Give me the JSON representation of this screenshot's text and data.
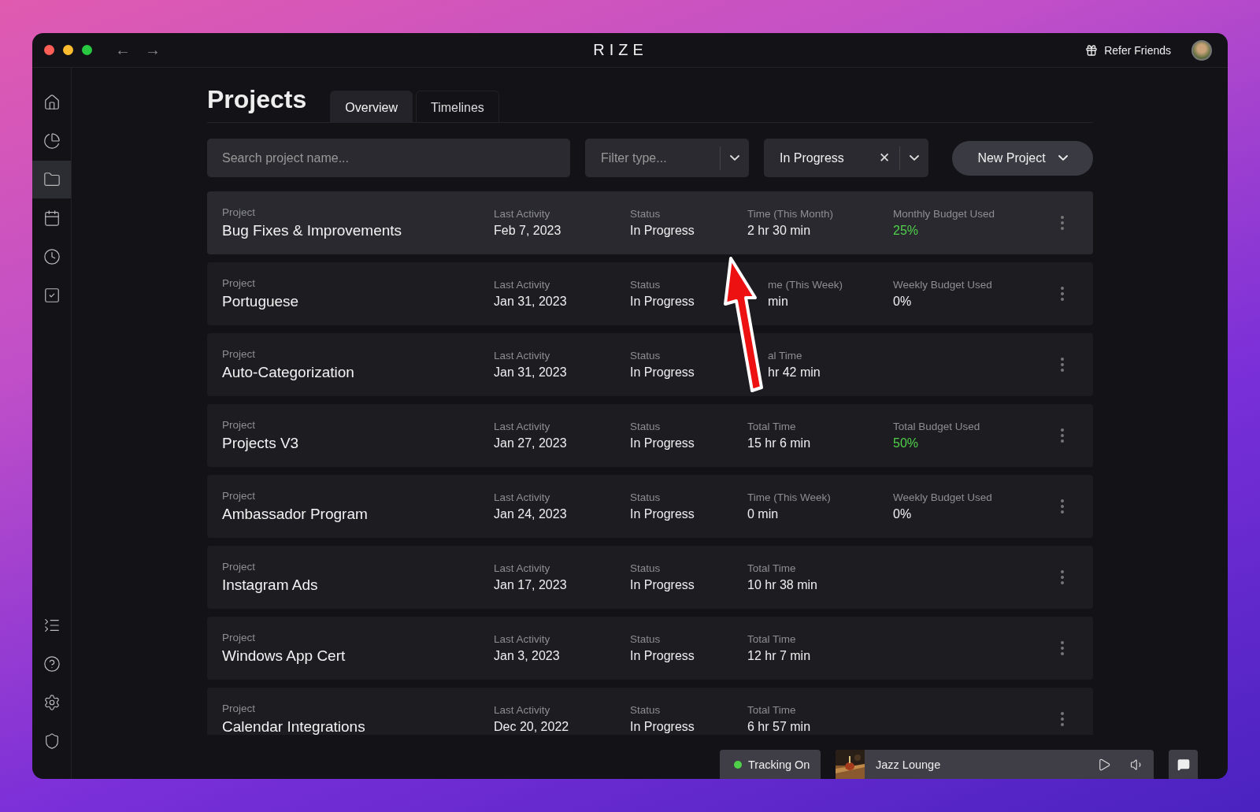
{
  "titlebar": {
    "back": "←",
    "forward": "→",
    "logo": "RIZE",
    "refer": "Refer Friends"
  },
  "sidebar": {
    "top": [
      {
        "selected": false
      },
      {
        "selected": false
      },
      {
        "selected": true
      },
      {
        "selected": false
      },
      {
        "selected": false
      },
      {
        "selected": false
      }
    ],
    "bottom": [
      {
        "selected": false
      },
      {
        "selected": false
      },
      {
        "selected": false
      },
      {
        "selected": false
      }
    ]
  },
  "page": {
    "title": "Projects",
    "tabs": [
      {
        "label": "Overview",
        "selected": true
      },
      {
        "label": "Timelines",
        "selected": false
      }
    ]
  },
  "toolbar": {
    "search": {
      "placeholder": "Search project name..."
    },
    "filter": {
      "placeholder": "Filter type..."
    },
    "status_filter": {
      "value": "In Progress",
      "clear": "✕"
    },
    "new_project": "New Project"
  },
  "rows": [
    {
      "selected": true,
      "name_label": "Project",
      "name": "Bug Fixes & Improvements",
      "activity_label": "Last Activity",
      "activity": "Feb 7, 2023",
      "status_label": "Status",
      "status": "In Progress",
      "time_label": "Time (This Month)",
      "time": "2 hr 30 min",
      "time_cut": false,
      "budget_label": "Monthly Budget Used",
      "budget": "25%",
      "color": "#4fd14a"
    },
    {
      "selected": false,
      "name_label": "Project",
      "name": "Portuguese",
      "activity_label": "Last Activity",
      "activity": "Jan 31, 2023",
      "status_label": "Status",
      "status": "In Progress",
      "time_label": "me (This Week)",
      "time": "min",
      "time_cut": true,
      "budget_label": "Weekly Budget Used",
      "budget": "0%",
      "color": "#f2f2f2"
    },
    {
      "selected": false,
      "name_label": "Project",
      "name": "Auto-Categorization",
      "activity_label": "Last Activity",
      "activity": "Jan 31, 2023",
      "status_label": "Status",
      "status": "In Progress",
      "time_label": "al Time",
      "time": "hr 42 min",
      "time_cut": true
    },
    {
      "selected": false,
      "name_label": "Project",
      "name": "Projects V3",
      "activity_label": "Last Activity",
      "activity": "Jan 27, 2023",
      "status_label": "Status",
      "status": "In Progress",
      "time_label": "Total Time",
      "time": "15 hr 6 min",
      "time_cut": false,
      "budget_label": "Total Budget Used",
      "budget": "50%",
      "color": "#4fd14a"
    },
    {
      "selected": false,
      "name_label": "Project",
      "name": "Ambassador Program",
      "activity_label": "Last Activity",
      "activity": "Jan 24, 2023",
      "status_label": "Status",
      "status": "In Progress",
      "time_label": "Time (This Week)",
      "time": "0 min",
      "time_cut": false,
      "budget_label": "Weekly Budget Used",
      "budget": "0%",
      "color": "#f2f2f2"
    },
    {
      "selected": false,
      "name_label": "Project",
      "name": "Instagram Ads",
      "activity_label": "Last Activity",
      "activity": "Jan 17, 2023",
      "status_label": "Status",
      "status": "In Progress",
      "time_label": "Total Time",
      "time": "10 hr 38 min",
      "time_cut": false
    },
    {
      "selected": false,
      "name_label": "Project",
      "name": "Windows App Cert",
      "activity_label": "Last Activity",
      "activity": "Jan 3, 2023",
      "status_label": "Status",
      "status": "In Progress",
      "time_label": "Total Time",
      "time": "12 hr 7 min",
      "time_cut": false
    },
    {
      "selected": false,
      "name_label": "Project",
      "name": "Calendar Integrations",
      "activity_label": "Last Activity",
      "activity": "Dec 20, 2022",
      "status_label": "Status",
      "status": "In Progress",
      "time_label": "Total Time",
      "time": "6 hr 57 min",
      "time_cut": false
    }
  ],
  "bottom_bar": {
    "tracking": {
      "label": "Tracking On",
      "on": true
    },
    "music": {
      "kind": "picture",
      "title": "Jazz Lounge"
    }
  },
  "annotation": {
    "kind": "arrow"
  }
}
